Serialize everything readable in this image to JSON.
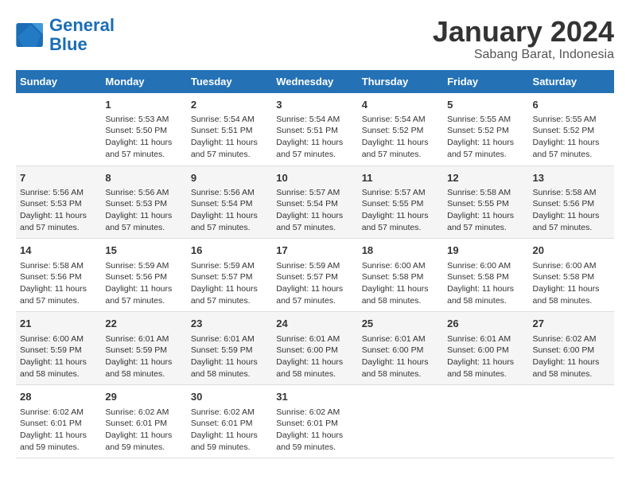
{
  "logo": {
    "line1": "General",
    "line2": "Blue"
  },
  "title": "January 2024",
  "subtitle": "Sabang Barat, Indonesia",
  "days_of_week": [
    "Sunday",
    "Monday",
    "Tuesday",
    "Wednesday",
    "Thursday",
    "Friday",
    "Saturday"
  ],
  "weeks": [
    [
      {
        "day": "",
        "detail": ""
      },
      {
        "day": "1",
        "detail": "Sunrise: 5:53 AM\nSunset: 5:50 PM\nDaylight: 11 hours\nand 57 minutes."
      },
      {
        "day": "2",
        "detail": "Sunrise: 5:54 AM\nSunset: 5:51 PM\nDaylight: 11 hours\nand 57 minutes."
      },
      {
        "day": "3",
        "detail": "Sunrise: 5:54 AM\nSunset: 5:51 PM\nDaylight: 11 hours\nand 57 minutes."
      },
      {
        "day": "4",
        "detail": "Sunrise: 5:54 AM\nSunset: 5:52 PM\nDaylight: 11 hours\nand 57 minutes."
      },
      {
        "day": "5",
        "detail": "Sunrise: 5:55 AM\nSunset: 5:52 PM\nDaylight: 11 hours\nand 57 minutes."
      },
      {
        "day": "6",
        "detail": "Sunrise: 5:55 AM\nSunset: 5:52 PM\nDaylight: 11 hours\nand 57 minutes."
      }
    ],
    [
      {
        "day": "7",
        "detail": "Sunrise: 5:56 AM\nSunset: 5:53 PM\nDaylight: 11 hours\nand 57 minutes."
      },
      {
        "day": "8",
        "detail": "Sunrise: 5:56 AM\nSunset: 5:53 PM\nDaylight: 11 hours\nand 57 minutes."
      },
      {
        "day": "9",
        "detail": "Sunrise: 5:56 AM\nSunset: 5:54 PM\nDaylight: 11 hours\nand 57 minutes."
      },
      {
        "day": "10",
        "detail": "Sunrise: 5:57 AM\nSunset: 5:54 PM\nDaylight: 11 hours\nand 57 minutes."
      },
      {
        "day": "11",
        "detail": "Sunrise: 5:57 AM\nSunset: 5:55 PM\nDaylight: 11 hours\nand 57 minutes."
      },
      {
        "day": "12",
        "detail": "Sunrise: 5:58 AM\nSunset: 5:55 PM\nDaylight: 11 hours\nand 57 minutes."
      },
      {
        "day": "13",
        "detail": "Sunrise: 5:58 AM\nSunset: 5:56 PM\nDaylight: 11 hours\nand 57 minutes."
      }
    ],
    [
      {
        "day": "14",
        "detail": "Sunrise: 5:58 AM\nSunset: 5:56 PM\nDaylight: 11 hours\nand 57 minutes."
      },
      {
        "day": "15",
        "detail": "Sunrise: 5:59 AM\nSunset: 5:56 PM\nDaylight: 11 hours\nand 57 minutes."
      },
      {
        "day": "16",
        "detail": "Sunrise: 5:59 AM\nSunset: 5:57 PM\nDaylight: 11 hours\nand 57 minutes."
      },
      {
        "day": "17",
        "detail": "Sunrise: 5:59 AM\nSunset: 5:57 PM\nDaylight: 11 hours\nand 57 minutes."
      },
      {
        "day": "18",
        "detail": "Sunrise: 6:00 AM\nSunset: 5:58 PM\nDaylight: 11 hours\nand 58 minutes."
      },
      {
        "day": "19",
        "detail": "Sunrise: 6:00 AM\nSunset: 5:58 PM\nDaylight: 11 hours\nand 58 minutes."
      },
      {
        "day": "20",
        "detail": "Sunrise: 6:00 AM\nSunset: 5:58 PM\nDaylight: 11 hours\nand 58 minutes."
      }
    ],
    [
      {
        "day": "21",
        "detail": "Sunrise: 6:00 AM\nSunset: 5:59 PM\nDaylight: 11 hours\nand 58 minutes."
      },
      {
        "day": "22",
        "detail": "Sunrise: 6:01 AM\nSunset: 5:59 PM\nDaylight: 11 hours\nand 58 minutes."
      },
      {
        "day": "23",
        "detail": "Sunrise: 6:01 AM\nSunset: 5:59 PM\nDaylight: 11 hours\nand 58 minutes."
      },
      {
        "day": "24",
        "detail": "Sunrise: 6:01 AM\nSunset: 6:00 PM\nDaylight: 11 hours\nand 58 minutes."
      },
      {
        "day": "25",
        "detail": "Sunrise: 6:01 AM\nSunset: 6:00 PM\nDaylight: 11 hours\nand 58 minutes."
      },
      {
        "day": "26",
        "detail": "Sunrise: 6:01 AM\nSunset: 6:00 PM\nDaylight: 11 hours\nand 58 minutes."
      },
      {
        "day": "27",
        "detail": "Sunrise: 6:02 AM\nSunset: 6:00 PM\nDaylight: 11 hours\nand 58 minutes."
      }
    ],
    [
      {
        "day": "28",
        "detail": "Sunrise: 6:02 AM\nSunset: 6:01 PM\nDaylight: 11 hours\nand 59 minutes."
      },
      {
        "day": "29",
        "detail": "Sunrise: 6:02 AM\nSunset: 6:01 PM\nDaylight: 11 hours\nand 59 minutes."
      },
      {
        "day": "30",
        "detail": "Sunrise: 6:02 AM\nSunset: 6:01 PM\nDaylight: 11 hours\nand 59 minutes."
      },
      {
        "day": "31",
        "detail": "Sunrise: 6:02 AM\nSunset: 6:01 PM\nDaylight: 11 hours\nand 59 minutes."
      },
      {
        "day": "",
        "detail": ""
      },
      {
        "day": "",
        "detail": ""
      },
      {
        "day": "",
        "detail": ""
      }
    ]
  ]
}
